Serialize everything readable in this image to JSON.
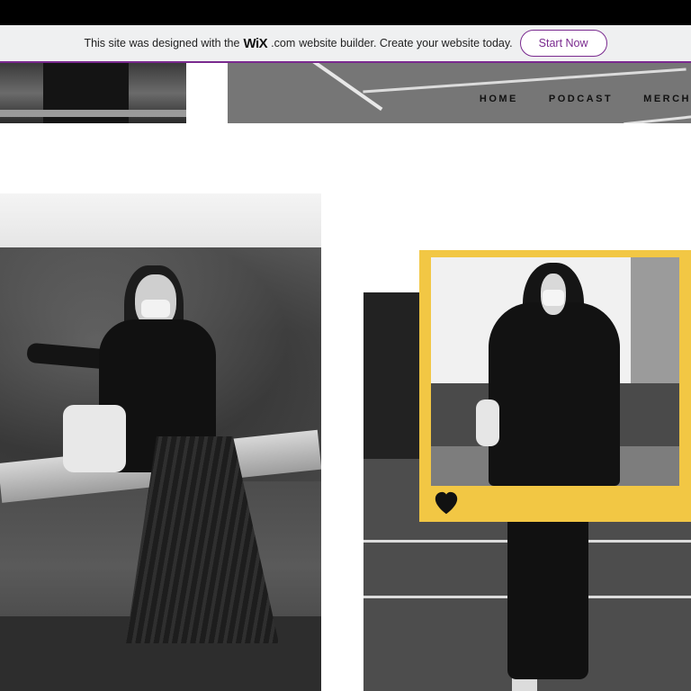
{
  "wix_banner": {
    "message_before": "This site was designed with the",
    "logo": "WiX",
    "logo_suffix": ".com",
    "message_after": "website builder. Create your website today.",
    "cta_label": "Start Now",
    "accent_color": "#7a2a8f"
  },
  "nav": {
    "items": [
      {
        "label": "HOME"
      },
      {
        "label": "PODCAST"
      },
      {
        "label": "MERCH"
      }
    ]
  },
  "frame": {
    "color": "#f2c744",
    "icon": "heart-icon"
  }
}
